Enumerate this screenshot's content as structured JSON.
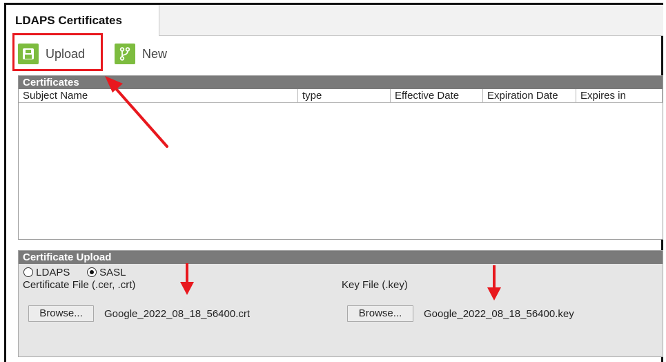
{
  "tab": {
    "title": "LDAPS Certificates"
  },
  "toolbar": {
    "upload_label": "Upload",
    "new_label": "New",
    "icon_color": "#7dbc3f"
  },
  "certificates": {
    "header": "Certificates",
    "columns": [
      "Subject Name",
      "type",
      "Effective Date",
      "Expiration Date",
      "Expires in"
    ],
    "rows": []
  },
  "upload": {
    "header": "Certificate Upload",
    "radio_options": [
      {
        "label": "LDAPS",
        "checked": false
      },
      {
        "label": "SASL",
        "checked": true
      }
    ],
    "cert_file_label": "Certificate File (.cer, .crt)",
    "key_file_label": "Key File (.key)",
    "browse_label": "Browse...",
    "cert_file_value": "Google_2022_08_18_56400.crt",
    "key_file_value": "Google_2022_08_18_56400.key"
  },
  "annotation_color": "#e8181e"
}
